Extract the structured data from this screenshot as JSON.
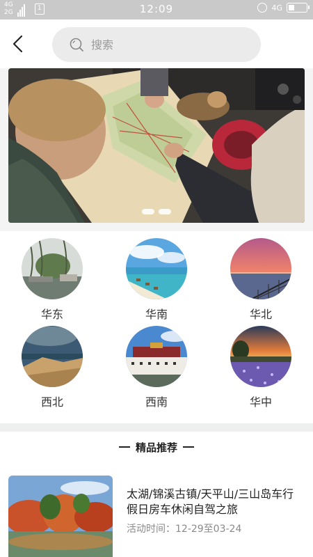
{
  "status_bar": {
    "network_top": "4G",
    "network_bottom": "2G",
    "sim_label": "1",
    "time": "12:09",
    "network_right": "4G"
  },
  "search": {
    "placeholder": "搜索"
  },
  "banner": {
    "dot_count": 2
  },
  "regions": [
    {
      "label": "华东",
      "icon": "region-east-china-photo"
    },
    {
      "label": "华南",
      "icon": "region-south-china-photo"
    },
    {
      "label": "华北",
      "icon": "region-north-china-photo"
    },
    {
      "label": "西北",
      "icon": "region-northwest-photo"
    },
    {
      "label": "西南",
      "icon": "region-southwest-photo"
    },
    {
      "label": "华中",
      "icon": "region-central-china-photo"
    }
  ],
  "featured": {
    "section_title": "精品推荐",
    "items": [
      {
        "title": "太湖/锦溪古镇/天平山/三山岛车行假日房车休闲自驾之旅",
        "time": "活动时间：12-29至03-24"
      }
    ]
  },
  "colors": {
    "status_bar_bg": "#c9c9c9",
    "search_bg": "#ebebeb",
    "divider": "#eef0f0"
  }
}
